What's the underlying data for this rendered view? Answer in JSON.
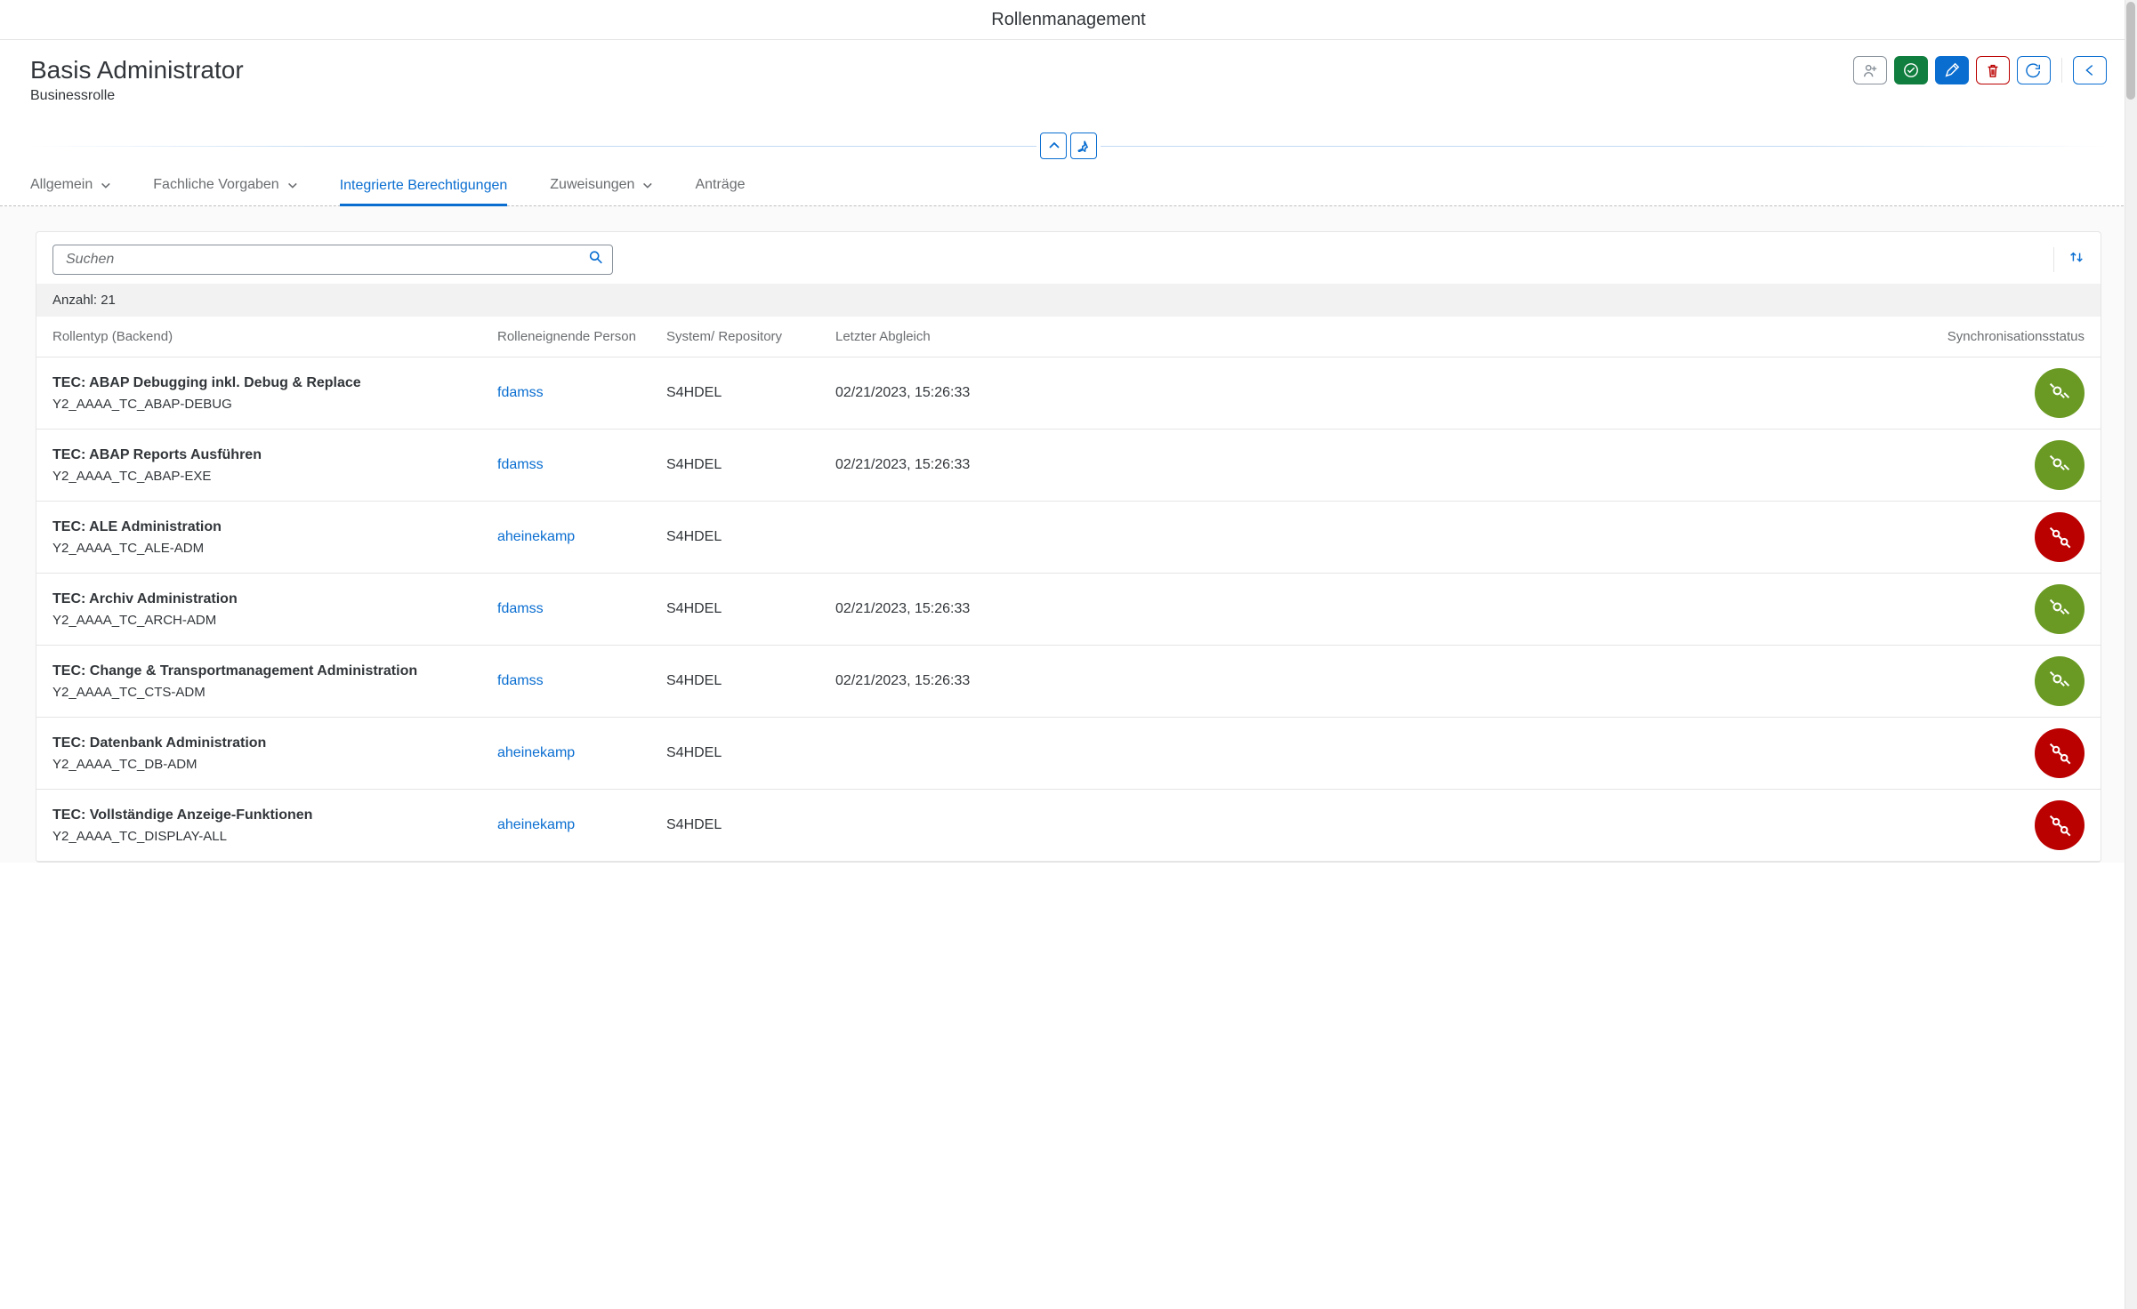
{
  "appbar": {
    "title": "Rollenmanagement"
  },
  "header": {
    "title": "Basis Administrator",
    "subtitle": "Businessrolle"
  },
  "tabs": [
    {
      "label": "Allgemein",
      "hasChevron": true,
      "active": false
    },
    {
      "label": "Fachliche Vorgaben",
      "hasChevron": true,
      "active": false
    },
    {
      "label": "Integrierte Berechtigungen",
      "hasChevron": false,
      "active": true
    },
    {
      "label": "Zuweisungen",
      "hasChevron": true,
      "active": false
    },
    {
      "label": "Anträge",
      "hasChevron": false,
      "active": false
    }
  ],
  "search": {
    "placeholder": "Suchen"
  },
  "count": {
    "label": "Anzahl:",
    "value": "21"
  },
  "columns": {
    "c1": "Rollentyp (Backend)",
    "c2": "Rolleneignende Person",
    "c3": "System/ Repository",
    "c4": "Letzter Abgleich",
    "c5": "Synchronisationsstatus"
  },
  "rows": [
    {
      "name": "TEC: ABAP Debugging inkl. Debug & Replace",
      "code": "Y2_AAAA_TC_ABAP-DEBUG",
      "owner": "fdamss",
      "system": "S4HDEL",
      "last": "02/21/2023, 15:26:33",
      "status": "ok"
    },
    {
      "name": "TEC: ABAP Reports Ausführen",
      "code": "Y2_AAAA_TC_ABAP-EXE",
      "owner": "fdamss",
      "system": "S4HDEL",
      "last": "02/21/2023, 15:26:33",
      "status": "ok"
    },
    {
      "name": "TEC: ALE Administration",
      "code": "Y2_AAAA_TC_ALE-ADM",
      "owner": "aheinekamp",
      "system": "S4HDEL",
      "last": "",
      "status": "err"
    },
    {
      "name": "TEC: Archiv Administration",
      "code": "Y2_AAAA_TC_ARCH-ADM",
      "owner": "fdamss",
      "system": "S4HDEL",
      "last": "02/21/2023, 15:26:33",
      "status": "ok"
    },
    {
      "name": "TEC: Change & Transportmanagement Administration",
      "code": "Y2_AAAA_TC_CTS-ADM",
      "owner": "fdamss",
      "system": "S4HDEL",
      "last": "02/21/2023, 15:26:33",
      "status": "ok"
    },
    {
      "name": "TEC: Datenbank Administration",
      "code": "Y2_AAAA_TC_DB-ADM",
      "owner": "aheinekamp",
      "system": "S4HDEL",
      "last": "",
      "status": "err"
    },
    {
      "name": "TEC: Vollständige Anzeige-Funktionen",
      "code": "Y2_AAAA_TC_DISPLAY-ALL",
      "owner": "aheinekamp",
      "system": "S4HDEL",
      "last": "",
      "status": "err"
    }
  ]
}
